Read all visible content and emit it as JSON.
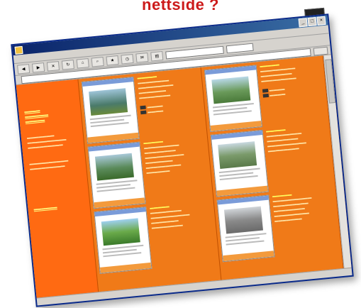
{
  "heading": "nettside ?",
  "window": {
    "title": "",
    "menu": [
      "",
      "",
      "",
      "",
      "",
      ""
    ],
    "address_label": "",
    "address_value": "",
    "go_label": "",
    "status_text": "",
    "status_zone": ""
  },
  "icons": [
    "back-icon",
    "forward-icon",
    "stop-icon",
    "refresh-icon",
    "home-icon",
    "search-icon",
    "favorites-icon",
    "history-icon",
    "mail-icon",
    "print-icon"
  ],
  "colors": {
    "page_background": "#f07a18",
    "sidebar_background": "#ff6a12",
    "title_bar": "#0a246a",
    "heading": "#cc1a1a"
  }
}
